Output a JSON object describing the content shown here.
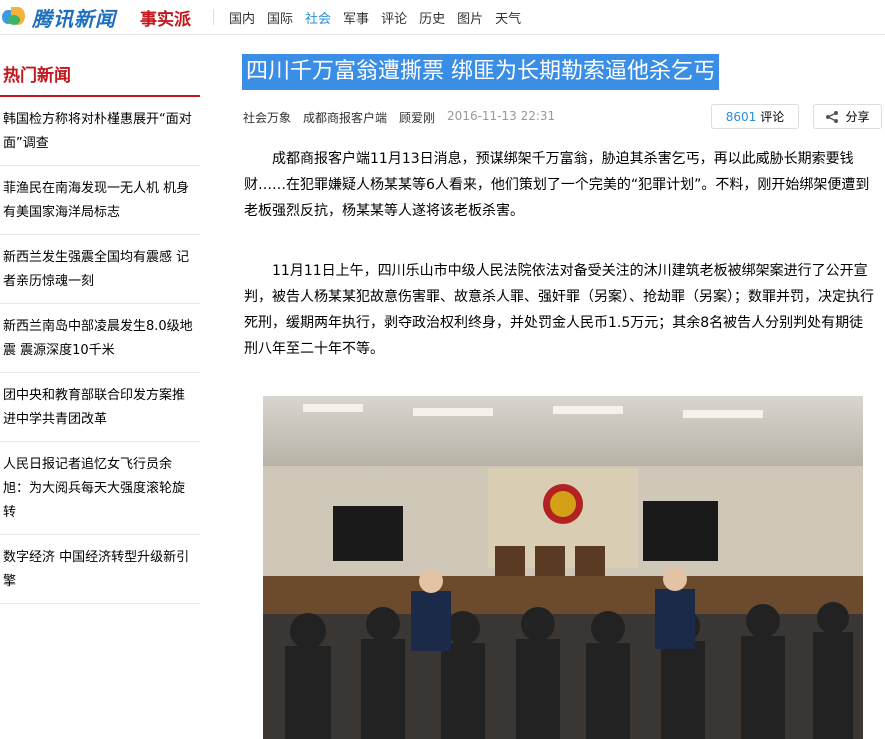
{
  "brand": {
    "logo_text": "腾讯新闻",
    "sub_logo": "事实派"
  },
  "nav": {
    "items": [
      "国内",
      "国际",
      "社会",
      "军事",
      "评论",
      "历史",
      "图片",
      "天气"
    ],
    "active": "社会"
  },
  "sidebar": {
    "title": "热门新闻",
    "items": [
      "韩国检方称将对朴槿惠展开“面对面”调查",
      "菲渔民在南海发现一无人机 机身有美国家海洋局标志",
      "新西兰发生强震全国均有震感 记者亲历惊魂一刻",
      "新西兰南岛中部凌晨发生8.0级地震 震源深度10千米",
      "团中央和教育部联合印发方案推进中学共青团改革",
      "人民日报记者追忆女飞行员余旭：为大阅兵每天大强度滚轮旋转",
      "数字经济 中国经济转型升级新引擎"
    ]
  },
  "article": {
    "headline": "四川千万富翁遭撕票 绑匪为长期勒索逼他杀乞丐",
    "meta": {
      "channel": "社会万象",
      "source": "成都商报客户端",
      "author": "顾爱刚",
      "date": "2016-11-13 22:31"
    },
    "comments": {
      "count": "8601",
      "label": "评论"
    },
    "share_label": "分享",
    "paragraphs": [
      "成都商报客户端11月13日消息，预谋绑架千万富翁，胁迫其杀害乞丐，再以此威胁长期索要钱财……在犯罪嫌疑人杨某某等6人看来，他们策划了一个完美的“犯罪计划”。不料，刚开始绑架便遭到老板强烈反抗，杨某某等人遂将该老板杀害。",
      "11月11日上午，四川乐山市中级人民法院依法对备受关注的沐川建筑老板被绑架案进行了公开宣判，被告人杨某某犯故意伤害罪、故意杀人罪、强奸罪（另案）、抢劫罪（另案）；数罪并罚，决定执行死刑，缓期两年执行，剥夺政治权利终身，并处罚金人民币1.5万元；其余8名被告人分别判处有期徒刑八年至二十年不等。"
    ]
  },
  "colors": {
    "accent_red": "#c3171c",
    "highlight_blue": "#3a8ee6",
    "link_blue": "#2a8fd7"
  }
}
